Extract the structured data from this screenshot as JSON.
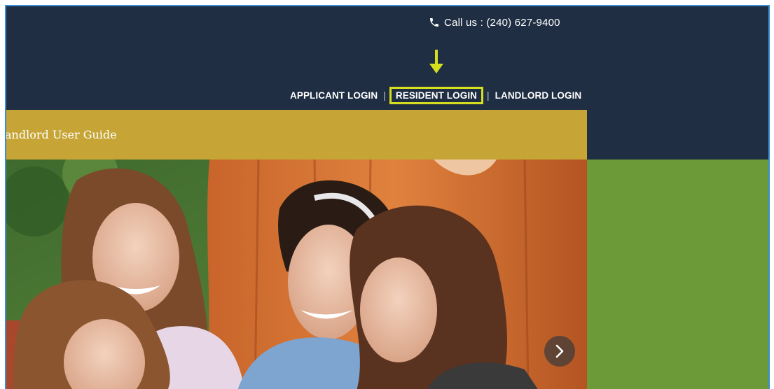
{
  "header": {
    "call_us": "Call us : (240) 627-9400"
  },
  "nav": {
    "applicant_login": "APPLICANT LOGIN",
    "resident_login": "RESIDENT LOGIN",
    "landlord_login": "LANDLORD LOGIN",
    "separator": "|"
  },
  "banner": {
    "title": "andlord User Guide"
  },
  "colors": {
    "header_bg": "#1f2e43",
    "gold_bar": "#c6a536",
    "green_panel": "#6c9a39",
    "highlight": "#d6df1f",
    "frame_border": "#3b8ed4"
  },
  "icons": {
    "phone": "phone-icon",
    "arrow": "arrow-down-icon",
    "next": "chevron-right-icon"
  }
}
